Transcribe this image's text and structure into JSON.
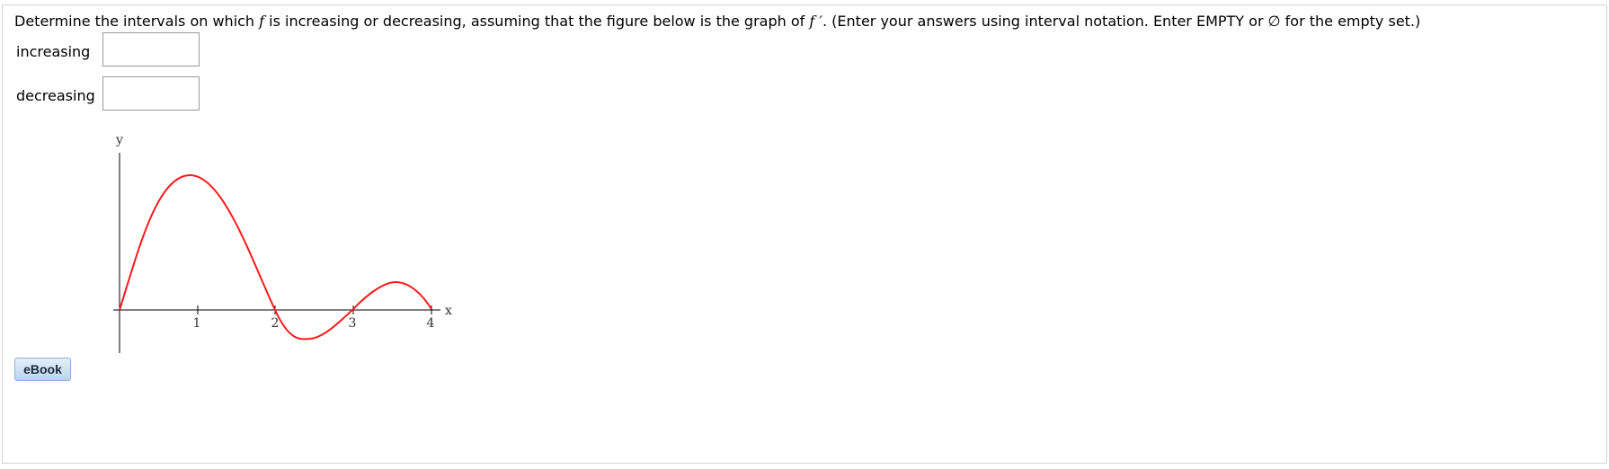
{
  "question": {
    "text_before": "Determine the intervals on which ",
    "f_symbol": "f",
    "text_middle": " is increasing or decreasing, assuming that the figure below is the graph of ",
    "fprime_symbol": "f ′",
    "text_after": ".  (Enter your answers using interval notation. Enter EMPTY or ∅ for the empty set.)"
  },
  "answers": {
    "increasing_label": "increasing",
    "increasing_value": "",
    "decreasing_label": "decreasing",
    "decreasing_value": ""
  },
  "graph": {
    "y_label": "y",
    "x_label": "x",
    "x_ticks": [
      "1",
      "2",
      "3",
      "4"
    ],
    "curve_color": "#ff1a1a"
  },
  "ebook_button": {
    "label": "eBook"
  }
}
